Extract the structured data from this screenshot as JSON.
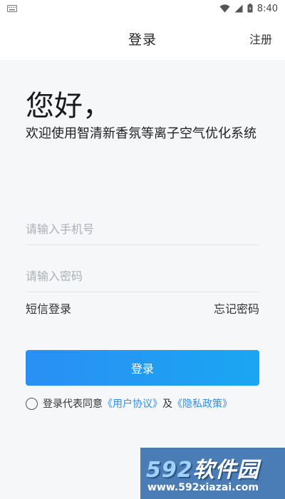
{
  "status_bar": {
    "time": "8:40",
    "icons": [
      "keyboard-icon",
      "wifi-icon",
      "signal-icon",
      "battery-icon"
    ]
  },
  "header": {
    "title": "登录",
    "action_label": "注册"
  },
  "greeting": "您好，",
  "welcome": "欢迎使用智清新香氛等离子空气优化系统",
  "form": {
    "phone_placeholder": "请输入手机号",
    "password_placeholder": "请输入密码",
    "sms_login": "短信登录",
    "forgot_password": "忘记密码",
    "login_button": "登录"
  },
  "agreement": {
    "prefix": "登录代表同意",
    "user_agreement": "《用户协议》",
    "and": "及",
    "privacy_policy": "《隐私政策》",
    "checked": false
  },
  "watermark": {
    "logo_num": "592",
    "logo_text": "软件园",
    "url": "www.592xiazai.com"
  },
  "colors": {
    "accent": "#2a8ff4",
    "background": "#f6f7f9",
    "watermark_bg": "#4a7db5"
  }
}
